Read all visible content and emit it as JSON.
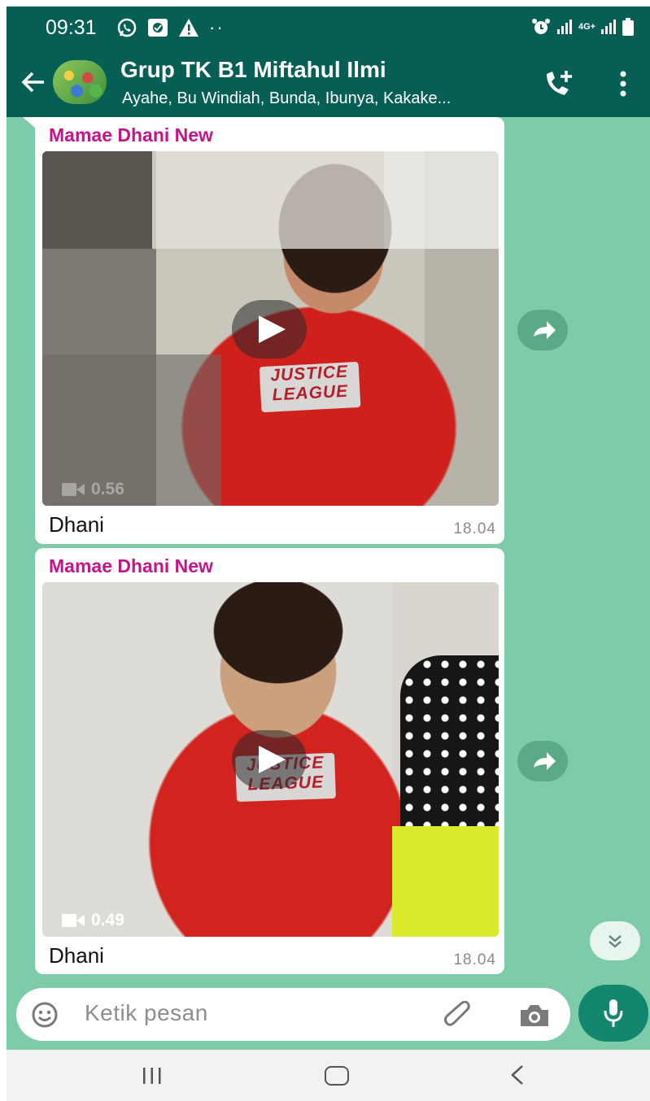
{
  "status_bar": {
    "time": "09:31",
    "network_label": "4G+"
  },
  "header": {
    "title": "Grup TK B1 Miftahul Ilmi",
    "members": "Ayahe, Bu Windiah, Bunda, Ibunya, Kakake..."
  },
  "messages": [
    {
      "sender": "Mamae Dhani New",
      "thumbnail_text": "JUSTICE LEAGUE",
      "duration": "0.56",
      "caption": "Dhani",
      "time": "18.04"
    },
    {
      "sender": "Mamae Dhani New",
      "thumbnail_text": "JUSTICE LEAGUE",
      "duration": "0.49",
      "caption": "Dhani",
      "time": "18.04"
    }
  ],
  "input": {
    "placeholder": "Ketik pesan"
  },
  "colors": {
    "header": "#075e54",
    "chat_background": "#7dcba8",
    "sender_name": "#c2158a",
    "mic_button": "#12876e"
  },
  "icons": [
    "back-arrow-icon",
    "add-call-icon",
    "menu-icon",
    "play-icon",
    "video-camera-icon",
    "forward-icon",
    "scroll-down-icon",
    "emoji-icon",
    "attach-icon",
    "camera-icon",
    "mic-icon"
  ]
}
